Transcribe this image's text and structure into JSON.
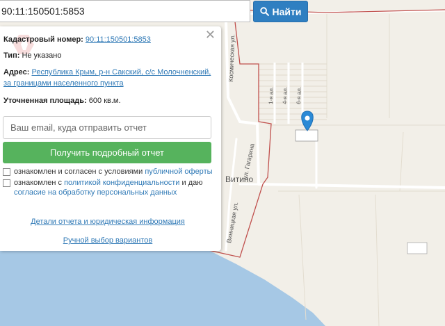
{
  "search": {
    "value": "90:11:150501:5853",
    "button_label": "Найти"
  },
  "panel": {
    "cadastral_label": "Кадастровый номер:",
    "cadastral_value": "90:11:150501:5853",
    "type_label": "Тип:",
    "type_value": "Не указано",
    "address_label": "Адрес:",
    "address_value_line1": "Республика Крым, р-н Сакский, с/с Молочненский,",
    "address_value_line2": "за границами населенного пункта",
    "area_label": "Уточненная площадь:",
    "area_value": "600 кв.м.",
    "email_placeholder": "Ваш email, куда отправить отчет",
    "report_button": "Получить подробный отчет",
    "consent1_text": "ознакомлен и согласен с условиями",
    "consent1_link": "публичной оферты",
    "consent2_text": "ознакомлен с",
    "consent2_link1": "политикой конфиденциальности",
    "consent2_mid": "и даю",
    "consent2_link2": "согласие на обработку персональных данных",
    "details_link": "Детали отчета и юридическая информация",
    "manual_link": "Ручной выбор вариантов"
  },
  "map": {
    "street_kosmicheskaya": "Космическая ул.",
    "street_gagarina": "ул. Гагарина",
    "street_vinnitskaya": "Винницкая ул.",
    "street_1ya": "1-я ал.",
    "street_4ya": "4-я ал.",
    "street_6ya": "6-я ал.",
    "village": "Витино",
    "colors": {
      "land": "#f2efe8",
      "water": "#a5c7e6",
      "boundary": "#c0504d",
      "road": "#ffffff",
      "marker": "#2b8ad6"
    }
  },
  "icons": {
    "search": "search-icon",
    "close": "close-icon",
    "marker": "map-marker-icon"
  }
}
